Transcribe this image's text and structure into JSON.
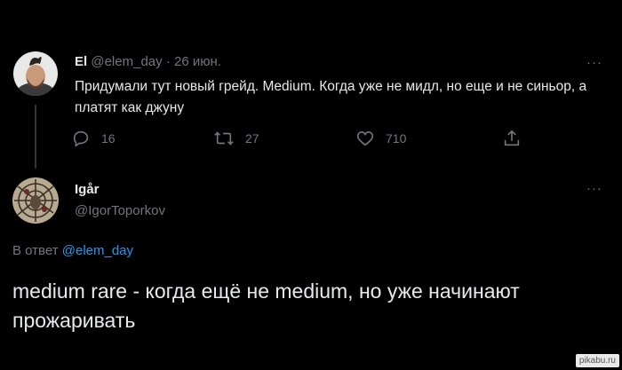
{
  "tweet1": {
    "author_name": "El",
    "handle": "@elem_day",
    "separator": "·",
    "date": "26 июн.",
    "text": "Придумали тут новый грейд. Medium. Когда уже не мидл, но еще и не синьор, а платят как джуну",
    "replies": "16",
    "retweets": "27",
    "likes": "710",
    "more": "···"
  },
  "tweet2": {
    "author_name": "Igår",
    "handle": "@IgorToporkov",
    "more": "···",
    "reply_prefix": "В ответ",
    "reply_to": "@elem_day",
    "text": "medium rare - когда ещё не medium, но уже начинают прожаривать"
  },
  "watermark": "pikabu.ru",
  "colors": {
    "background": "#000000",
    "text": "#e7e9ea",
    "muted": "#71767b",
    "link": "#1d9bf0"
  },
  "icons": {
    "reply": "reply-icon",
    "retweet": "retweet-icon",
    "like": "heart-icon",
    "share": "share-icon",
    "more": "more-icon"
  }
}
